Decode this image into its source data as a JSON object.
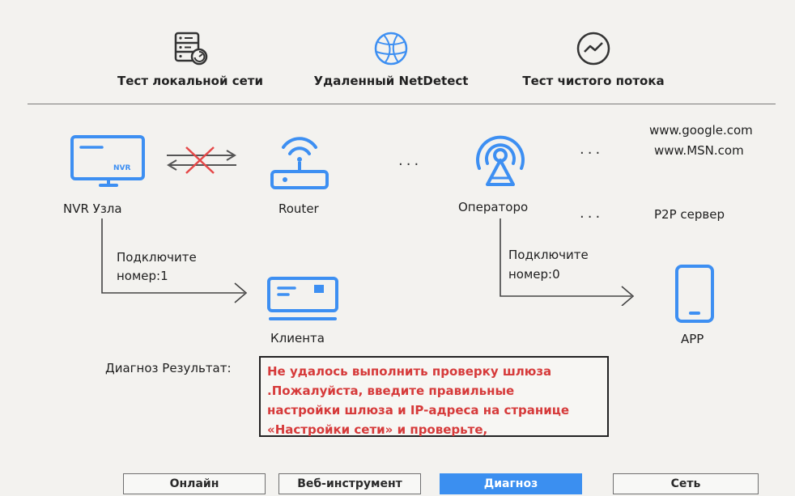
{
  "tabs": [
    {
      "label": "Тест локальной сети",
      "icon": "server-icon"
    },
    {
      "label": "Удаленный NetDetect",
      "icon": "globe-icon"
    },
    {
      "label": "Тест чистого потока",
      "icon": "pulse-icon"
    }
  ],
  "diagram": {
    "nvr_label": "NVR Узла",
    "nvr_icon_text": "NVR",
    "router_label": "Router",
    "operator_label": "Операторо",
    "client_label": "Клиента",
    "app_label": "APP",
    "dots": "...",
    "websites": [
      "www.google.com",
      "www.MSN.com"
    ],
    "p2p_label": "P2P сервер",
    "connect_left": {
      "line1": "Подключите",
      "line2": "номер:1"
    },
    "connect_right": {
      "line1": "Подключите",
      "line2": "номер:0"
    }
  },
  "diagnosis": {
    "label": "Диагноз Результат:",
    "lines": [
      "Не удалось выполнить проверку шлюза",
      ".Пожалуйста, введите правильные",
      "настройки шлюза и IP-адреса на странице",
      "«Настройки сети» и проверьте,"
    ]
  },
  "buttons": [
    {
      "label": "Онлайн",
      "active": false
    },
    {
      "label": "Веб-инструмент",
      "active": false
    },
    {
      "label": "Диагноз",
      "active": true
    },
    {
      "label": "Сеть",
      "active": false
    }
  ],
  "colors": {
    "accent": "#3b8ff0",
    "error": "#d63a3a",
    "icon_blue": "#3d8ff2"
  }
}
